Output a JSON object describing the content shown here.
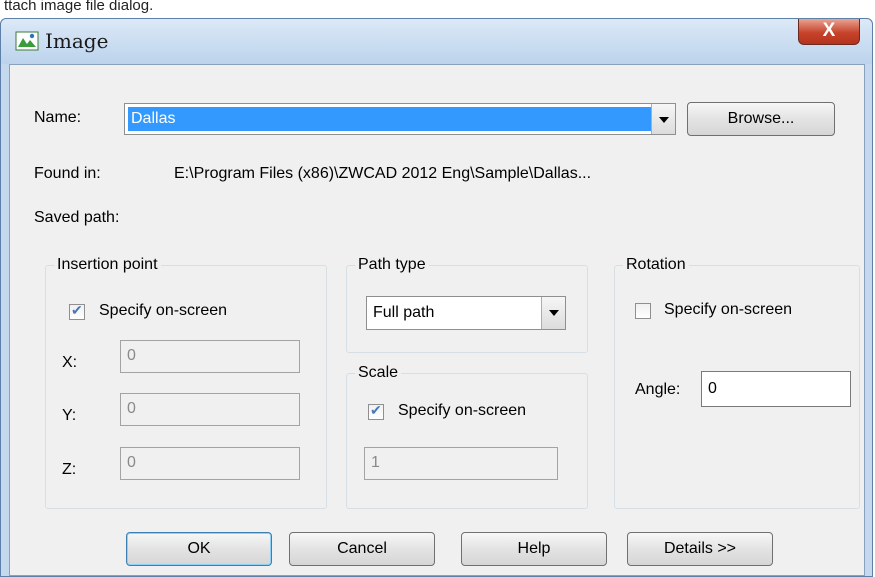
{
  "header_caption": "ttach image file dialog.",
  "window": {
    "title": "Image",
    "close_label": "X"
  },
  "name": {
    "label": "Name:",
    "value": "Dallas",
    "browse_label": "Browse..."
  },
  "found_in": {
    "label": "Found in:",
    "value": "E:\\Program Files (x86)\\ZWCAD 2012 Eng\\Sample\\Dallas..."
  },
  "saved_path": {
    "label": "Saved path:",
    "value": ""
  },
  "insertion": {
    "title": "Insertion point",
    "specify_label": "Specify on-screen",
    "specify_checked": true,
    "x_label": "X:",
    "x_value": "0",
    "y_label": "Y:",
    "y_value": "0",
    "z_label": "Z:",
    "z_value": "0"
  },
  "path_type": {
    "title": "Path type",
    "selected": "Full path"
  },
  "scale": {
    "title": "Scale",
    "specify_label": "Specify on-screen",
    "specify_checked": true,
    "value": "1"
  },
  "rotation": {
    "title": "Rotation",
    "specify_label": "Specify on-screen",
    "specify_checked": false,
    "angle_label": "Angle:",
    "angle_value": "0"
  },
  "buttons": {
    "ok": "OK",
    "cancel": "Cancel",
    "help": "Help",
    "details": "Details >>"
  },
  "colors": {
    "selection": "#3399ff",
    "titlebar": "#c4d8ee",
    "dialog_bg": "#f0f0f0",
    "close_button": "#c7432b"
  }
}
